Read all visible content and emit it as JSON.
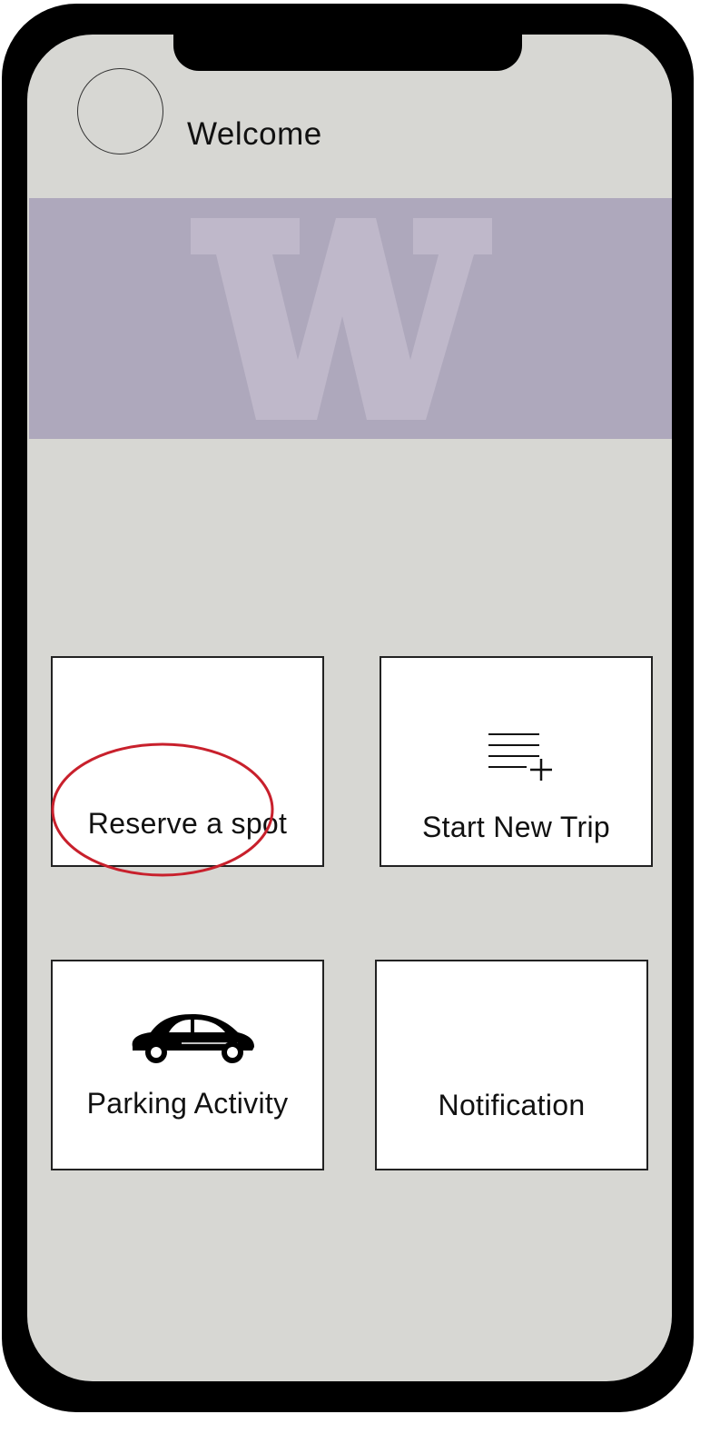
{
  "header": {
    "welcome_text": "Welcome"
  },
  "banner": {
    "logo_letter": "W",
    "background_color": "#aea8bc",
    "logo_color": "#bfb8ca"
  },
  "tiles": [
    {
      "label": "Reserve a spot",
      "icon": "none"
    },
    {
      "label": "Start New Trip",
      "icon": "add-list-icon"
    },
    {
      "label": "Parking Activity",
      "icon": "car-icon"
    },
    {
      "label": "Notification",
      "icon": "none"
    }
  ],
  "annotation": {
    "shape": "ellipse",
    "color": "#c8202c",
    "target": "Reserve a spot"
  },
  "colors": {
    "screen": "#d7d7d3",
    "frame": "#000000",
    "tile": "#ffffff"
  }
}
